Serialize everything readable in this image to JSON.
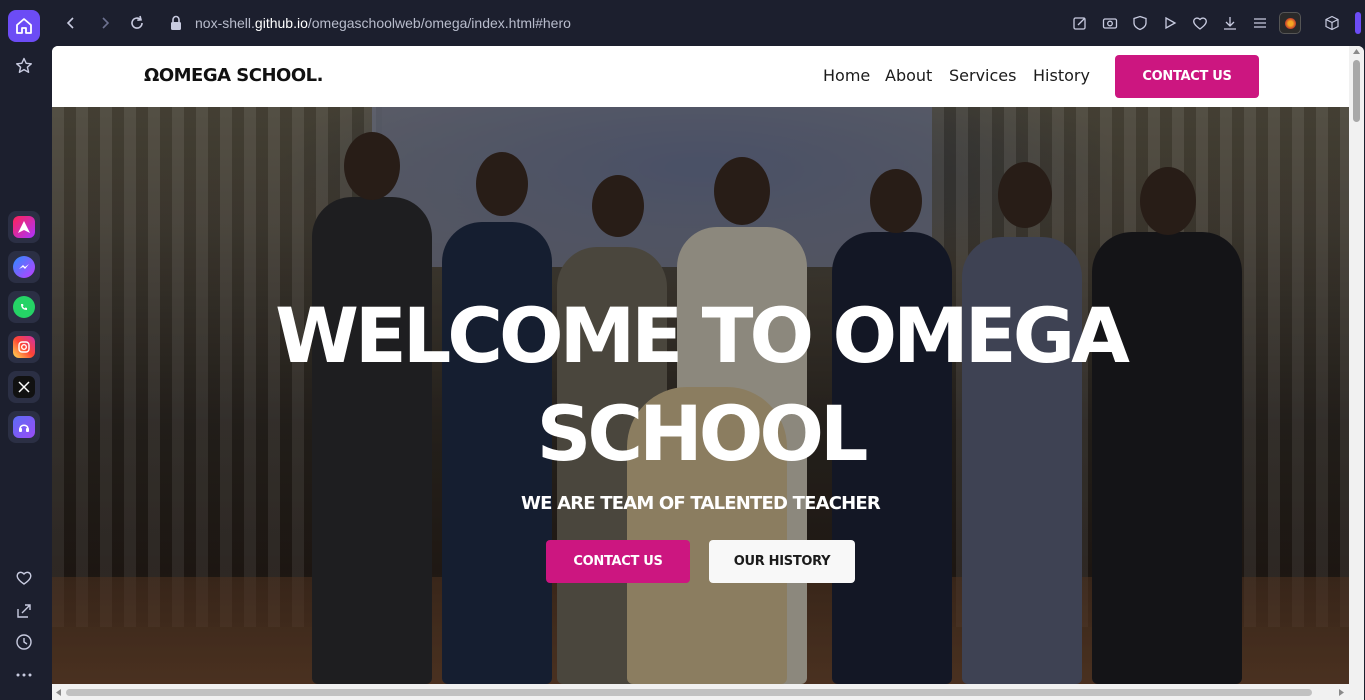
{
  "browser": {
    "url_prefix": "nox-shell.",
    "url_domain": "github.io",
    "url_path": "/omegaschoolweb/omega/index.html#hero"
  },
  "sidebar": {
    "apps": [
      {
        "name": "aria",
        "color": "#ffffff"
      },
      {
        "name": "messenger",
        "color": "#9b5cff"
      },
      {
        "name": "whatsapp",
        "color": "#25d366"
      },
      {
        "name": "instagram",
        "color": "#e1306c"
      },
      {
        "name": "x",
        "color": "#111111"
      },
      {
        "name": "music",
        "color": "#5b6cf5"
      }
    ]
  },
  "site": {
    "logo_symbol": "Ω",
    "logo_text": "OMEGA SCHOOL.",
    "nav": [
      "Home",
      "About",
      "Services",
      "History"
    ],
    "nav_cta": "CONTACT US",
    "accent": "#cc1680"
  },
  "hero": {
    "title_line1": "WELCOME TO OMEGA",
    "title_line2": "SCHOOL",
    "subtitle": "WE ARE TEAM OF TALENTED TEACHER",
    "btn_contact": "CONTACT US",
    "btn_history": "OUR HISTORY"
  }
}
